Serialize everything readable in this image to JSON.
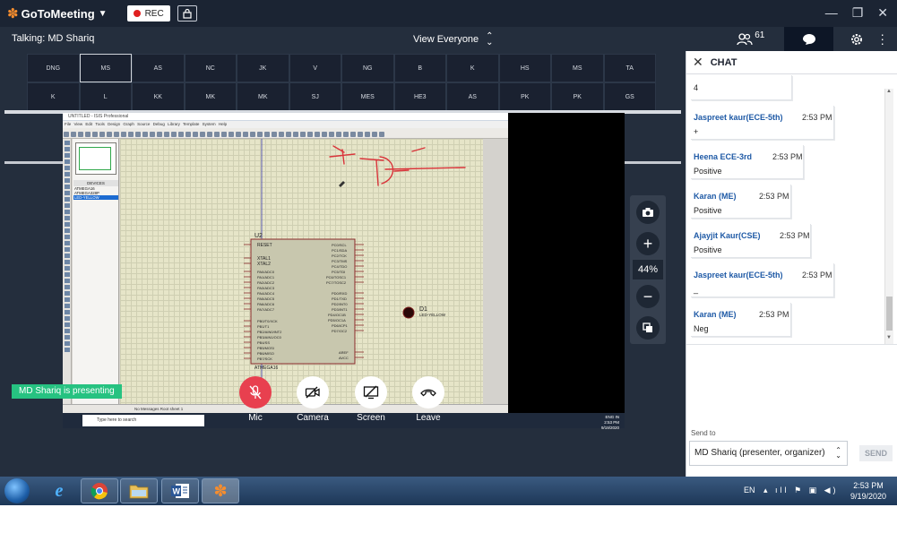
{
  "app": {
    "name": "GoToMeeting",
    "rec_label": "REC",
    "window_controls": [
      "—",
      "❐",
      "✕"
    ]
  },
  "topbar": {
    "talking": "Talking: MD Shariq",
    "view": "View Everyone",
    "participant_count": "61"
  },
  "tiles": [
    "DNG",
    "MS",
    "AS",
    "NC",
    "JK",
    "V",
    "NG",
    "B",
    "K",
    "HS",
    "MS",
    "TA",
    "K",
    "L",
    "KK",
    "MK",
    "MK",
    "SJ",
    "MES",
    "HE3",
    "AS",
    "PK",
    "PK",
    "GS"
  ],
  "shared": {
    "title": "UNTITLED - ISIS Professional",
    "menu": "File View Edit Tools Design Graph Source Debug Library Template System Help",
    "devices_header": "DEVICES",
    "devices": [
      "ATMEGA16",
      "ATMEGA328P",
      "LED-YELLOW"
    ],
    "status_text": "No Messages     Root sheet 1",
    "search_placeholder": "Type here to search",
    "clock_time": "2:53 PM",
    "clock_date": "9/19/2020",
    "clock_lang": "ENG IN"
  },
  "zoom": {
    "value": "44%"
  },
  "presenting": "MD Shariq is presenting",
  "controls": {
    "mic": "Mic",
    "camera": "Camera",
    "screen": "Screen",
    "leave": "Leave"
  },
  "chat": {
    "title": "CHAT",
    "messages": [
      {
        "text": "4"
      },
      {
        "sender": "Jaspreet kaur(ECE-5th)",
        "time": "2:53 PM",
        "text": "+"
      },
      {
        "sender": "Heena ECE-3rd",
        "time": "2:53 PM",
        "text": "Positive"
      },
      {
        "sender": "Karan (ME)",
        "time": "2:53 PM",
        "text": "Positive"
      },
      {
        "sender": "Ajayjit Kaur(CSE)",
        "time": "2:53 PM",
        "text": "Positive"
      },
      {
        "sender": "Jaspreet kaur(ECE-5th)",
        "time": "2:53 PM",
        "text": "_"
      },
      {
        "sender": "Karan (ME)",
        "time": "2:53 PM",
        "text": "Neg"
      }
    ],
    "send_to_label": "Send to",
    "recipient": "MD Shariq (presenter, organizer)",
    "send_button": "SEND"
  },
  "taskbar": {
    "lang": "EN",
    "time": "2:53 PM",
    "date": "9/19/2020"
  },
  "colors": {
    "brand_orange": "#f68d2e",
    "presenting_green": "#26c281",
    "mic_red": "#e8404f",
    "chat_name_blue": "#1f5aa6"
  }
}
